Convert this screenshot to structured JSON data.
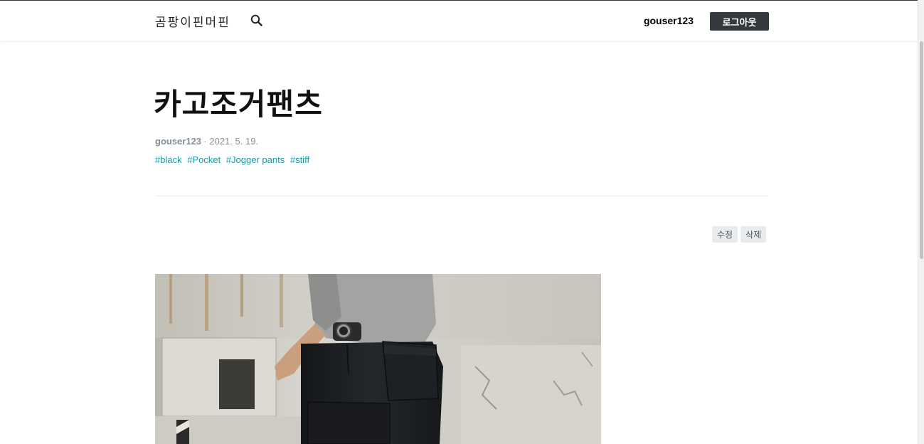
{
  "header": {
    "brand": "곰팡이핀머핀",
    "username": "gouser123",
    "logout_label": "로그아웃"
  },
  "post": {
    "title": "카고조거팬츠",
    "author": "gouser123",
    "date": "2021. 5. 19.",
    "tags": [
      "#black",
      "#Pocket",
      "#Jogger pants",
      "#stiff"
    ]
  },
  "actions": {
    "edit_label": "수정",
    "delete_label": "삭제"
  },
  "icons": {
    "search": "search-icon"
  },
  "colors": {
    "accent_dark": "#343a40",
    "tag": "#1c9aa5",
    "meta": "#868e96"
  }
}
